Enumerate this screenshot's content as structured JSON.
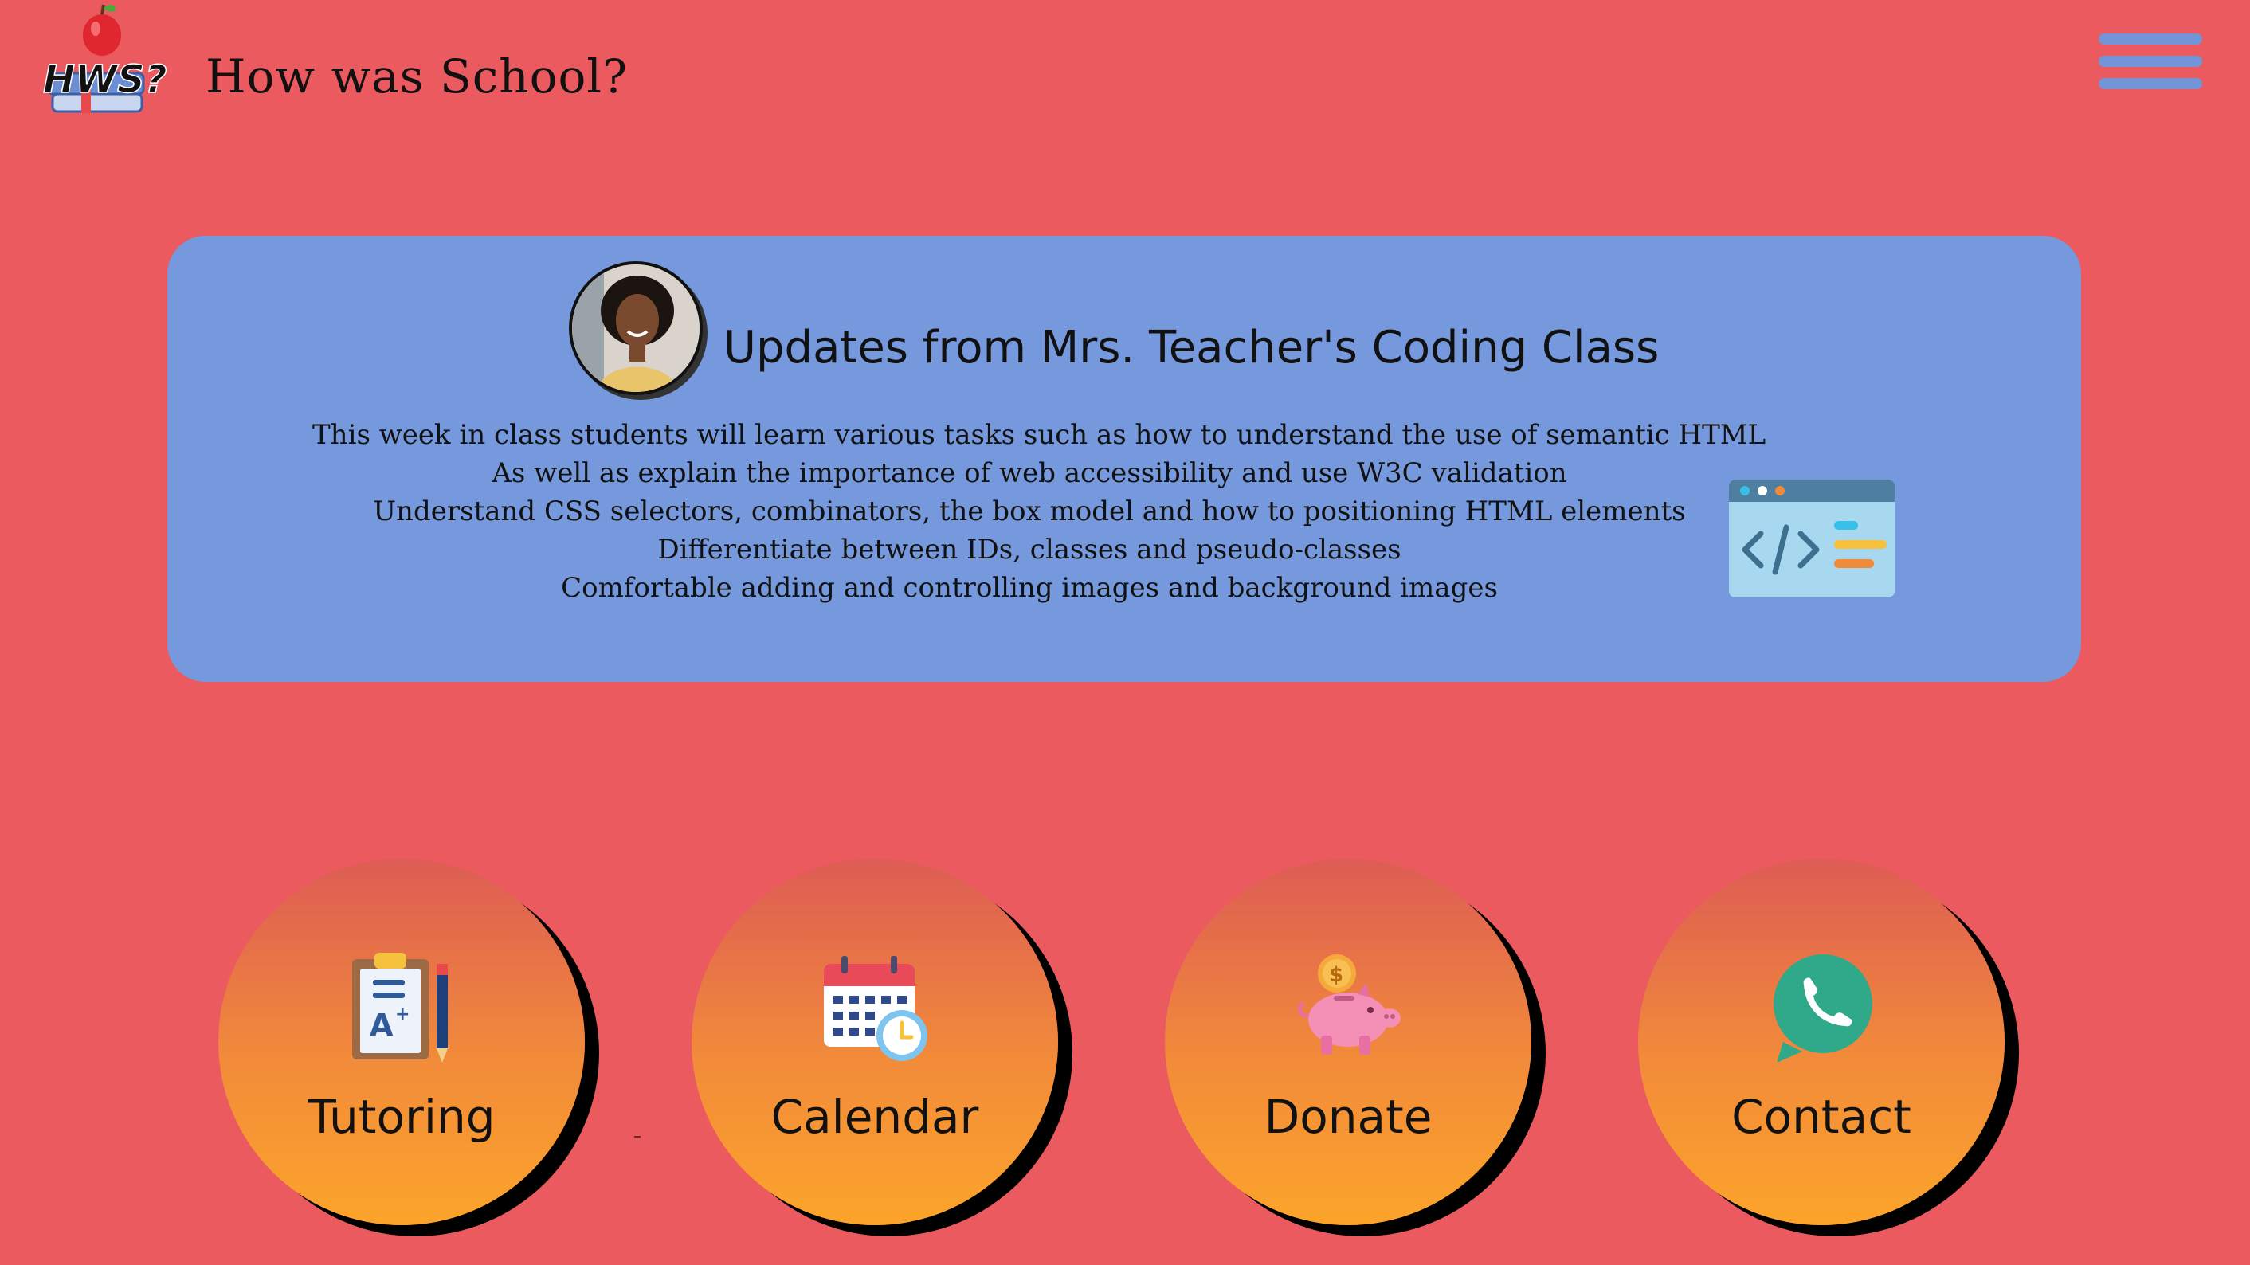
{
  "header": {
    "logo_icon": "hws-logo-icon",
    "logo_text": "HWS?",
    "title": "How was School?",
    "menu_icon": "hamburger-menu-icon"
  },
  "update": {
    "avatar_icon": "teacher-avatar-icon",
    "title": "Updates from Mrs. Teacher's Coding Class",
    "lines": [
      "This week in class students will learn various tasks such as how to understand the use of semantic HTML",
      "As well as explain the importance of web accessibility and use W3C validation",
      "Understand CSS selectors, combinators, the box model and how to positioning HTML elements",
      "Differentiate between IDs, classes and pseudo-classes",
      "Comfortable adding and controlling images and background images"
    ],
    "illustration_icon": "code-window-icon"
  },
  "nav": [
    {
      "label": "Tutoring",
      "icon": "clipboard-grade-icon"
    },
    {
      "label": "Calendar",
      "icon": "calendar-clock-icon"
    },
    {
      "label": "Donate",
      "icon": "piggy-bank-icon"
    },
    {
      "label": "Contact",
      "icon": "phone-chat-icon"
    }
  ],
  "colors": {
    "background": "#eb5a5f",
    "card": "#7599dc",
    "menu_bars": "#7394d6",
    "circle_top": "#dd5c54",
    "circle_bottom": "#fca42a"
  }
}
